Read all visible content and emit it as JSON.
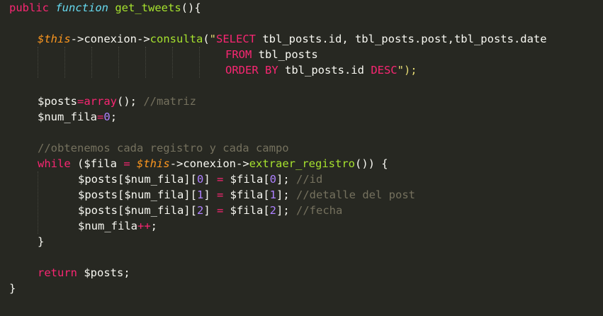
{
  "editor": {
    "theme_colors": {
      "background": "#272822",
      "keyword": "#f92672",
      "storage": "#66d9ef",
      "function": "#a6e22e",
      "variable": "#fd971f",
      "string": "#e6db74",
      "number": "#ae81ff",
      "comment": "#75715e",
      "text": "#f8f8f2"
    },
    "code": {
      "l1": {
        "public": "public",
        "function": "function",
        "name": "get_tweets",
        "rest": "(){"
      },
      "l2": {
        "this": "$this",
        "arrow1": "->conexion->",
        "method": "consulta",
        "open": "(",
        "quote": "\"",
        "sql1": "SELECT",
        "sql2": " tbl_posts.id, tbl_posts.post,tbl_posts.date"
      },
      "l3": {
        "from": "FROM",
        "table": " tbl_posts"
      },
      "l4": {
        "order": "ORDER BY",
        "col": " tbl_posts.id ",
        "desc": "DESC",
        "close": "\");"
      },
      "l5": {
        "var": "$posts",
        "eq": "=",
        "fn": "array",
        "rest": "();",
        "comment": " //matriz"
      },
      "l6": {
        "var": "$num_fila",
        "eq": "=",
        "num": "0",
        "rest": ";"
      },
      "l7": {
        "comment": "//obtenemos cada registro y cada campo"
      },
      "l8": {
        "while": "while",
        "open": " ($fila ",
        "eq": "=",
        "this": "$this",
        "arrow": "->conexion->",
        "method": "extraer_registro",
        "rest": "()) {"
      },
      "l9": {
        "a": "$posts[$num_fila][",
        "idx": "0",
        "b": "] ",
        "eq": "=",
        "c": " $fila[",
        "idx2": "0",
        "d": "];",
        "comment": " //id"
      },
      "l10": {
        "a": "$posts[$num_fila][",
        "idx": "1",
        "b": "] ",
        "eq": "=",
        "c": " $fila[",
        "idx2": "1",
        "d": "];",
        "comment": " //detalle del post"
      },
      "l11": {
        "a": "$posts[$num_fila][",
        "idx": "2",
        "b": "] ",
        "eq": "=",
        "c": " $fila[",
        "idx2": "2",
        "d": "];",
        "comment": " //fecha"
      },
      "l12": {
        "var": "$num_fila",
        "op": "++",
        "rest": ";"
      },
      "l13": {
        "text": "}"
      },
      "l14": {
        "return": "return",
        "rest": " $posts;"
      },
      "l15": {
        "text": "}"
      }
    }
  }
}
